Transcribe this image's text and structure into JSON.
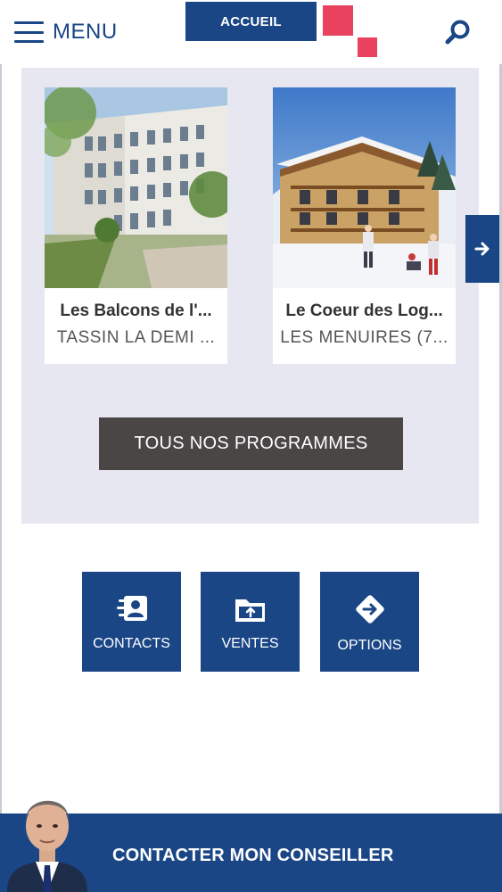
{
  "header": {
    "menu_label": "MENU",
    "home_tab": "ACCUEIL",
    "icons": {
      "menu": "hamburger-icon",
      "search": "search-icon"
    }
  },
  "carousel": {
    "cards": [
      {
        "title": "Les Balcons de l'...",
        "location": "TASSIN LA DEMI ..."
      },
      {
        "title": "Le Coeur des Log...",
        "location": "LES MENUIRES (7..."
      }
    ],
    "next_icon": "arrow-right-icon",
    "all_programs_label": "TOUS NOS PROGRAMMES"
  },
  "quick_actions": [
    {
      "label": "CONTACTS",
      "icon": "contacts-icon"
    },
    {
      "label": "VENTES",
      "icon": "folder-upload-icon"
    },
    {
      "label": "OPTIONS",
      "icon": "diamond-arrow-icon"
    }
  ],
  "advisor": {
    "label": "CONTACTER MON CONSEILLER"
  },
  "colors": {
    "brand_blue": "#1a4686",
    "brand_pink": "#e8425e",
    "panel_bg": "#e6e7f1",
    "dark_button": "#4a4646"
  }
}
